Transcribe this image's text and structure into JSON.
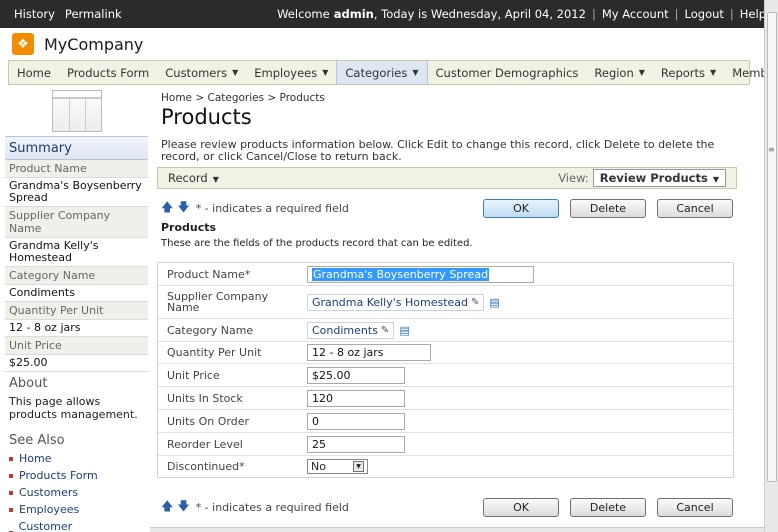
{
  "topbar": {
    "links": [
      "History",
      "Permalink"
    ],
    "welcome_prefix": "Welcome",
    "user": "admin",
    "date_text": ", Today is Wednesday, April 04, 2012",
    "my_account": "My Account",
    "logout": "Logout",
    "help": "Help",
    "separator": "|"
  },
  "brand": {
    "name": "MyCompany"
  },
  "menu": {
    "items": [
      {
        "label": "Home",
        "dropdown": false
      },
      {
        "label": "Products Form",
        "dropdown": false
      },
      {
        "label": "Customers",
        "dropdown": true
      },
      {
        "label": "Employees",
        "dropdown": true
      },
      {
        "label": "Categories",
        "dropdown": true,
        "active": true
      },
      {
        "label": "Customer Demographics",
        "dropdown": false
      },
      {
        "label": "Region",
        "dropdown": true
      },
      {
        "label": "Reports",
        "dropdown": true
      },
      {
        "label": "Membership",
        "dropdown": false
      }
    ]
  },
  "sidebar": {
    "summary_title": "Summary",
    "fields": [
      {
        "label": "Product Name",
        "value": "Grandma's Boysenberry Spread"
      },
      {
        "label": "Supplier Company Name",
        "value": "Grandma Kelly's Homestead"
      },
      {
        "label": "Category Name",
        "value": "Condiments"
      },
      {
        "label": "Quantity Per Unit",
        "value": "12 - 8 oz jars"
      },
      {
        "label": "Unit Price",
        "value": "$25.00"
      }
    ],
    "about_title": "About",
    "about_text": "This page allows products management.",
    "see_also_title": "See Also",
    "see_also": [
      "Home",
      "Products Form",
      "Customers",
      "Employees",
      "Customer Demographics"
    ]
  },
  "main": {
    "breadcrumb": "Home > Categories > Products",
    "title": "Products",
    "description": "Please review products information below. Click Edit to change this record, click Delete to delete the record, or click Cancel/Close to return back.",
    "record_label": "Record",
    "view_label": "View:",
    "view_value": "Review Products",
    "required_note": "* - indicates a required field",
    "buttons": {
      "ok": "OK",
      "delete": "Delete",
      "cancel": "Cancel"
    },
    "section_title": "Products",
    "section_desc": "These are the fields of the products record that can be edited.",
    "fields": {
      "product_name": {
        "label": "Product Name",
        "required": "*",
        "value": "Grandma's Boysenberry Spread"
      },
      "supplier": {
        "label": "Supplier Company Name",
        "value": "Grandma Kelly's Homestead"
      },
      "category": {
        "label": "Category Name",
        "value": "Condiments"
      },
      "quantity": {
        "label": "Quantity Per Unit",
        "value": "12 - 8 oz jars"
      },
      "unit_price": {
        "label": "Unit Price",
        "value": "$25.00"
      },
      "units_in_stock": {
        "label": "Units In Stock",
        "value": "120"
      },
      "units_on_order": {
        "label": "Units On Order",
        "value": "0"
      },
      "reorder_level": {
        "label": "Reorder Level",
        "value": "25"
      },
      "discontinued": {
        "label": "Discontinued",
        "required": "*",
        "value": "No"
      }
    }
  },
  "icons": {
    "up_arrow": "up-arrow-icon",
    "down_arrow": "down-arrow-icon",
    "pencil": "pencil-icon",
    "new_record": "new-record-icon",
    "logo": "company-logo-icon"
  },
  "colors": {
    "topbar": "#2b2b2b",
    "menu_bg": "#f0f2e4",
    "active_menu": "#dde6f2",
    "link": "#1b3f7a",
    "logo": "#f28c00"
  }
}
